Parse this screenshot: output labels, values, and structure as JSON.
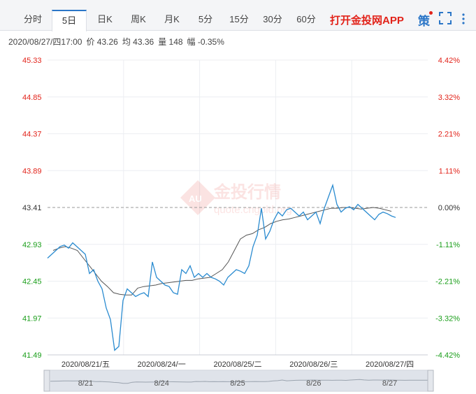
{
  "tabs": [
    {
      "label": "分时",
      "active": false
    },
    {
      "label": "5日",
      "active": true
    },
    {
      "label": "日K",
      "active": false
    },
    {
      "label": "周K",
      "active": false
    },
    {
      "label": "月K",
      "active": false
    },
    {
      "label": "5分",
      "active": false
    },
    {
      "label": "15分",
      "active": false
    },
    {
      "label": "30分",
      "active": false
    },
    {
      "label": "60分",
      "active": false
    }
  ],
  "promo_label": "打开金投网APP",
  "strategy_label": "策",
  "info": {
    "datetime": "2020/08/27/四17:00",
    "price": "价 43.26",
    "avg": "均 43.36",
    "volume": "量 148",
    "change": "幅 -0.35%"
  },
  "watermark": {
    "cn": "金投行情",
    "en": "quote.cngold.org",
    "badge": "AU"
  },
  "colors": {
    "price_line": "#2a8bd0",
    "avg_line": "#555555",
    "up": "#e2231a",
    "down": "#1a9e1a",
    "base": "#333333"
  },
  "chart_data": {
    "type": "line",
    "ylim": [
      41.49,
      45.33
    ],
    "base_price": 43.41,
    "left_ticks": [
      "45.33",
      "44.85",
      "44.37",
      "43.89",
      "43.41",
      "42.93",
      "42.45",
      "41.97",
      "41.49"
    ],
    "right_ticks": [
      "4.42%",
      "3.32%",
      "2.21%",
      "1.11%",
      "0.00%",
      "-1.11%",
      "-2.21%",
      "-3.32%",
      "-4.42%"
    ],
    "x_labels": [
      "2020/08/21/五",
      "2020/08/24/一",
      "2020/08/25/二",
      "2020/08/26/三",
      "2020/08/27/四"
    ],
    "navigator_labels": [
      "8/21",
      "8/24",
      "8/25",
      "8/26",
      "8/27"
    ],
    "series": [
      {
        "values": [
          42.75,
          42.8,
          42.85,
          42.9,
          42.92,
          42.88,
          42.95,
          42.9,
          42.85,
          42.8,
          42.55,
          42.6,
          42.45,
          42.35,
          42.1,
          41.95,
          41.55,
          41.6,
          42.2,
          42.35,
          42.3,
          42.25,
          42.28,
          42.3,
          42.25,
          42.7,
          42.5,
          42.45,
          42.4,
          42.38,
          42.3,
          42.28,
          42.6,
          42.55,
          42.65,
          42.5,
          42.55,
          42.5,
          42.55,
          42.5,
          42.48,
          42.45,
          42.4,
          42.5,
          42.55,
          42.6,
          42.58,
          42.55,
          42.65,
          42.9,
          43.05,
          43.4,
          43.0,
          43.1,
          43.25,
          43.35,
          43.3,
          43.38,
          43.4,
          43.35,
          43.3,
          43.35,
          43.25,
          43.3,
          43.35,
          43.2,
          43.4,
          43.55,
          43.7,
          43.45,
          43.35,
          43.4,
          43.42,
          43.38,
          43.45,
          43.4,
          43.35,
          43.3,
          43.25,
          43.32,
          43.35,
          43.33,
          43.3,
          43.28
        ]
      },
      {
        "values": [
          42.85,
          42.88,
          42.9,
          42.88,
          42.85,
          42.75,
          42.65,
          42.55,
          42.45,
          42.38,
          42.3,
          42.28,
          42.27,
          42.27,
          42.36,
          42.38,
          42.39,
          42.4,
          42.42,
          42.43,
          42.44,
          42.45,
          42.46,
          42.46,
          42.48,
          42.49,
          42.5,
          42.55,
          42.6,
          42.7,
          42.85,
          43.0,
          43.05,
          43.07,
          43.12,
          43.15,
          43.2,
          43.23,
          43.25,
          43.26,
          43.28,
          43.3,
          43.32,
          43.34,
          43.36,
          43.38,
          43.4,
          43.4,
          43.41,
          43.41,
          43.4,
          43.39,
          43.4,
          43.41,
          43.4,
          43.38,
          43.36
        ]
      }
    ]
  }
}
